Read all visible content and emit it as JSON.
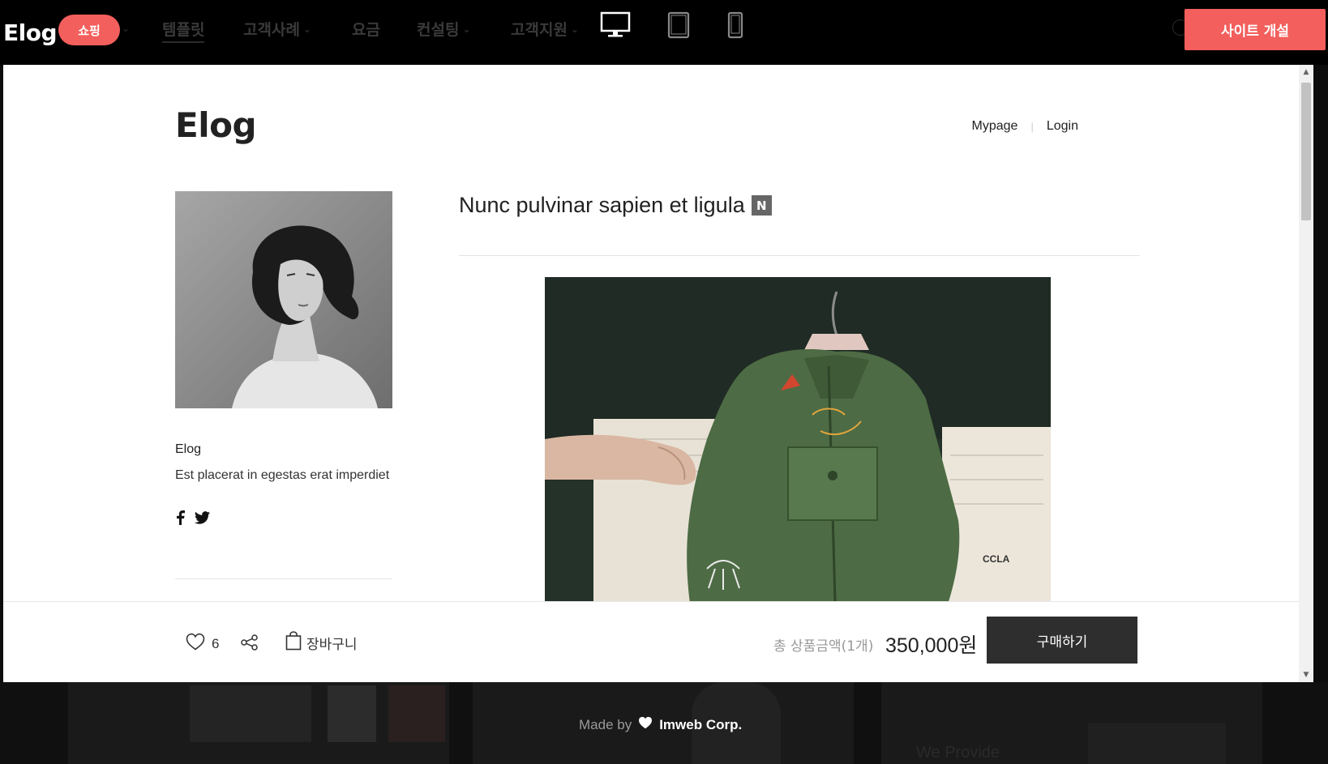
{
  "topbar": {
    "brand": "Elog",
    "pill_label": "쇼핑",
    "nav": [
      {
        "label": "템플릿"
      },
      {
        "label": "고객사례"
      },
      {
        "label": "요금"
      },
      {
        "label": "컨설팅"
      },
      {
        "label": "고객지원"
      }
    ],
    "devices": [
      "desktop-icon",
      "tablet-icon",
      "mobile-icon"
    ],
    "open_site_label": "사이트 개설",
    "accent_color": "#f25f5c"
  },
  "site": {
    "logo": "Elog",
    "links": [
      "Mypage",
      "Login"
    ]
  },
  "profile": {
    "name": "Elog",
    "description": "Est placerat in egestas erat imperdiet",
    "social": [
      "facebook-icon",
      "twitter-icon"
    ]
  },
  "post": {
    "title": "Nunc pulvinar sapien et ligula",
    "badge": "N"
  },
  "buybar": {
    "like_count": "6",
    "cart_label": "장바구니",
    "total_label": "총 상품금액(1개)",
    "total_price": "350,000원",
    "buy_label": "구매하기"
  },
  "footer": {
    "made_by": "Made by",
    "company": "Imweb Corp.",
    "bg_text": "We Provide"
  }
}
